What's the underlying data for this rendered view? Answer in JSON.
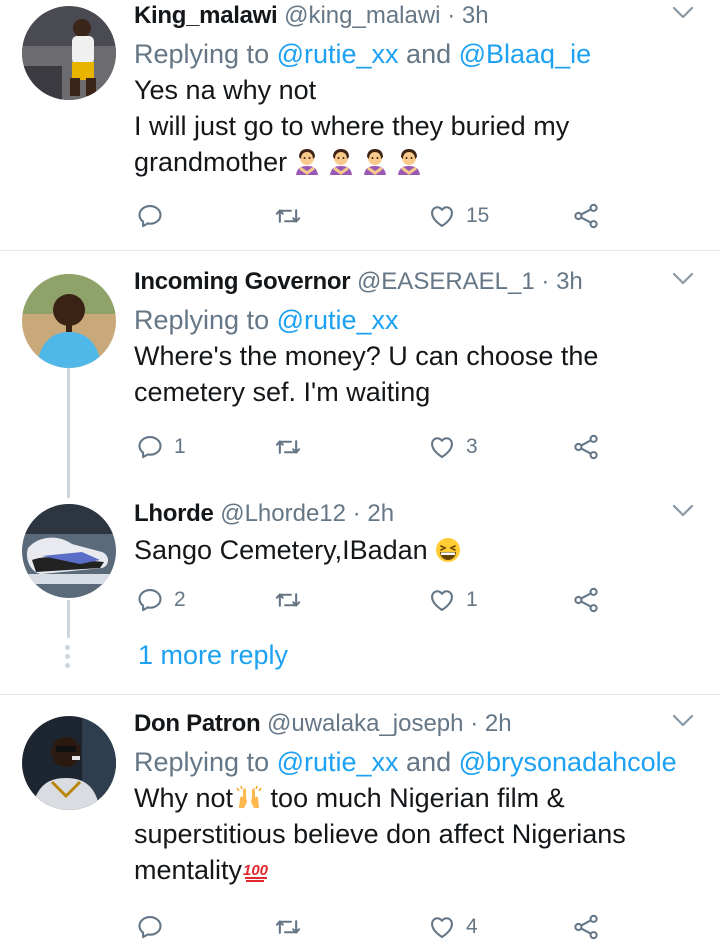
{
  "tweets": [
    {
      "name": "King_malawi",
      "handle": "@king_malawi",
      "time": "3h",
      "replying_prefix": "Replying to ",
      "replying_to": [
        "@rutie_xx",
        "@Blaaq_ie"
      ],
      "replying_join": " and ",
      "body_lines": [
        "Yes na why not",
        "I will just go to where they buried my",
        "grandmother"
      ],
      "trailing_emoji": "person-gesturing-no x4",
      "reply_count": "",
      "retweet_count": "",
      "like_count": "15"
    },
    {
      "name": "Incoming Governor",
      "handle": "@EASERAEL_1",
      "time": "3h",
      "replying_prefix": "Replying to ",
      "replying_to": [
        "@rutie_xx"
      ],
      "body_lines": [
        "Where's the money? U can choose the",
        "cemetery sef. I'm waiting"
      ],
      "reply_count": "1",
      "retweet_count": "",
      "like_count": "3"
    },
    {
      "name": "Lhorde",
      "handle": "@Lhorde12",
      "time": "2h",
      "body_lines": [
        "Sango Cemetery,IBadan"
      ],
      "trailing_emoji": "grinning-squinting-face",
      "reply_count": "2",
      "retweet_count": "",
      "like_count": "1"
    },
    {
      "name": "Don Patron",
      "handle": "@uwalaka_joseph",
      "time": "2h",
      "replying_prefix": "Replying to ",
      "replying_to": [
        "@rutie_xx",
        "@brysonadahcole"
      ],
      "replying_join": " and ",
      "body_lines": [
        "Why not",
        " too much Nigerian film &",
        "superstitious believe don affect Nigerians",
        "mentality"
      ],
      "reply_count": "",
      "retweet_count": "",
      "like_count": "4"
    }
  ],
  "thread": {
    "more_reply": "1 more reply"
  },
  "separator": "·",
  "colors": {
    "link": "#1da1f2",
    "muted": "#657786",
    "text": "#14171a",
    "divider": "#e1e8ed",
    "thread": "#ccd6dd"
  },
  "icons": [
    "reply-icon",
    "retweet-icon",
    "like-icon",
    "share-icon",
    "caret-down-icon"
  ]
}
